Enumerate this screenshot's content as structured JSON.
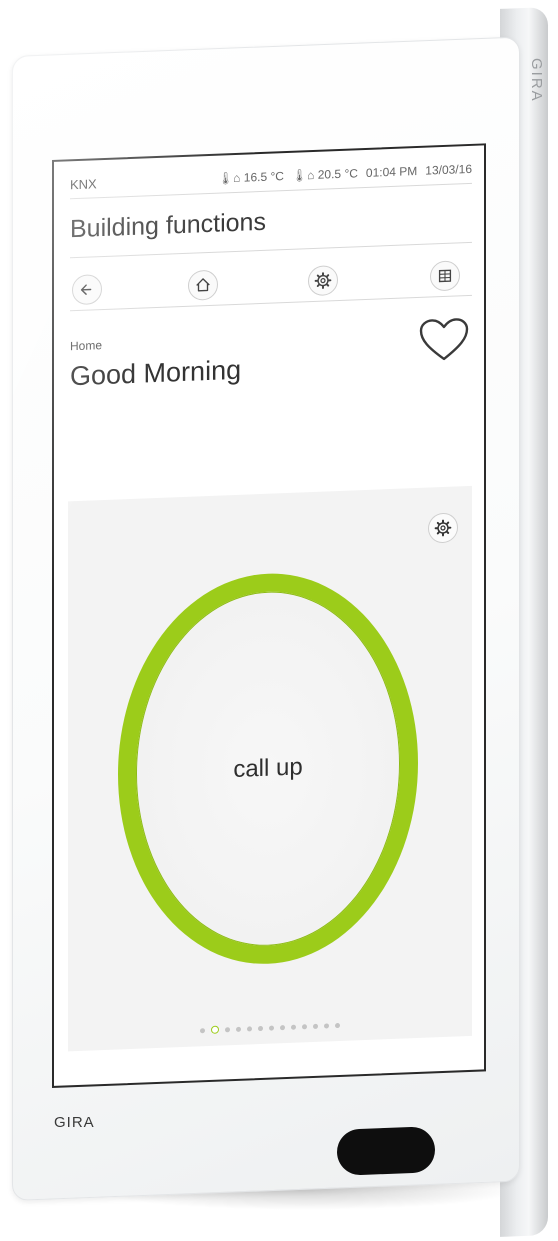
{
  "device": {
    "side_brand": "GIRA",
    "bottom_brand": "GIRA"
  },
  "status_bar": {
    "system": "KNX",
    "outdoor_temp": "16.5 °C",
    "indoor_temp": "20.5 °C",
    "time": "01:04 PM",
    "date": "13/03/16"
  },
  "header": {
    "title": "Building functions"
  },
  "nav": {
    "back_icon": "arrow-left-icon",
    "home_icon": "home-icon",
    "settings_icon": "gear-icon",
    "grid_icon": "grid-icon"
  },
  "scene": {
    "context": "Home",
    "title": "Good Morning",
    "favorite_icon": "heart-icon"
  },
  "tile": {
    "settings_icon": "gear-icon",
    "action_label": "call up",
    "ring_color": "#9ccc1a"
  },
  "pager": {
    "total": 13,
    "active_index": 1
  }
}
